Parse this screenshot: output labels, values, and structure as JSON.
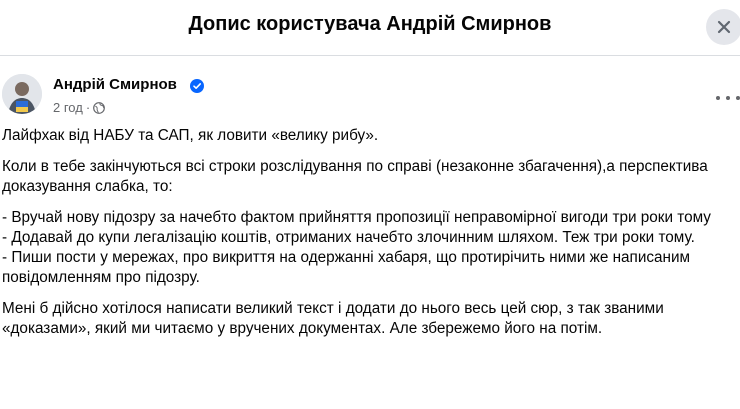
{
  "modal": {
    "title": "Допис користувача Андрій Смирнов",
    "close_icon": "close-icon"
  },
  "post": {
    "author": "Андрій Смирнов",
    "verified": true,
    "time": "2 год",
    "separator": "·",
    "audience_icon": "globe-icon",
    "more_icon": "more-options-icon",
    "paragraphs": [
      "Лайфхак від НАБУ та САП, як ловити «велику рибу».",
      "Коли в тебе закінчуються всі строки розслідування по справі (незаконне збагачення),а перспектива доказування слабка, то:",
      "- Вручай нову підозру за начебто фактом прийняття пропозиції неправомірної вигоди три роки тому\n- Додавай до купи легалізацію коштів, отриманих начебто злочинним шляхом. Теж три роки тому.\n- Пиши пости у мережах, про викриття на одержанні хабаря, що протирічить  ними же написаним повідомленням про підозру.",
      "Мені б дійсно хотілося написати великий текст і додати до нього весь цей сюр, з так званими «доказами», який ми читаємо у вручених документах. Але збережемо його на потім."
    ]
  },
  "colors": {
    "text": "#050505",
    "secondary_text": "#65676b",
    "verified_blue": "#0866ff",
    "close_bg": "#e4e6eb"
  }
}
